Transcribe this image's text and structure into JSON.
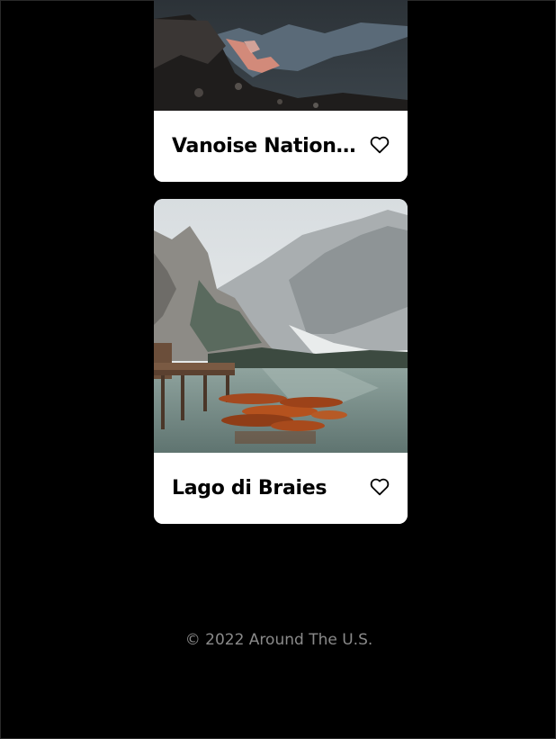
{
  "places": [
    {
      "title": "Vanoise National Park",
      "image_icon": "mountain-lake-reflection-photo",
      "liked": false
    },
    {
      "title": "Lago di Braies",
      "image_icon": "alpine-lake-boats-photo",
      "liked": false
    }
  ],
  "footer": {
    "copyright": "© 2022 Around The U.S."
  },
  "colors": {
    "background": "#000000",
    "card": "#ffffff",
    "footer_text": "#8a8a8a"
  }
}
